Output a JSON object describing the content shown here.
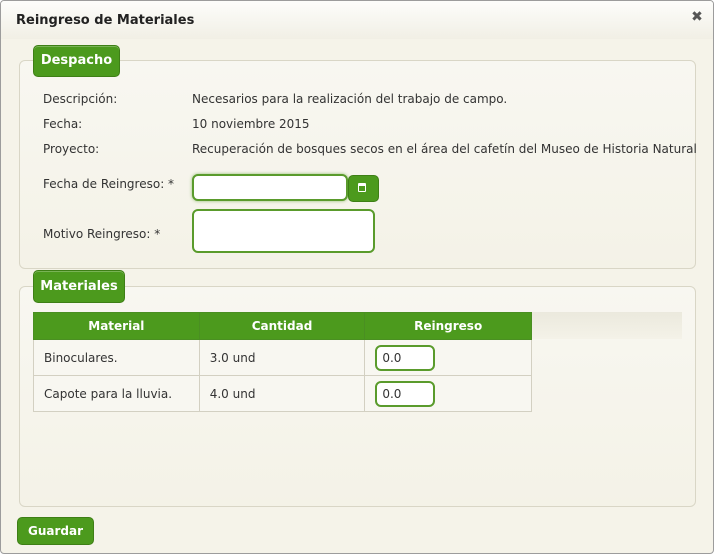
{
  "dialog": {
    "title": "Reingreso de Materiales",
    "close_icon": "close-icon"
  },
  "despacho": {
    "legend": "Despacho",
    "descripcion_label": "Descripción:",
    "descripcion_value": "Necesarios para la realización del trabajo de campo.",
    "fecha_label": "Fecha:",
    "fecha_value": "10 noviembre 2015",
    "proyecto_label": "Proyecto:",
    "proyecto_value": "Recuperación de bosques secos en el área del cafetín del Museo de Historia Natural",
    "fecha_reingreso_label": "Fecha de Reingreso:  *",
    "fecha_reingreso_value": "",
    "calendar_icon": "calendar-icon",
    "motivo_label": "Motivo Reingreso:  *",
    "motivo_value": ""
  },
  "materiales": {
    "legend": "Materiales",
    "columns": [
      "Material",
      "Cantidad",
      "Reingreso"
    ],
    "rows": [
      {
        "material": "Binoculares.",
        "cantidad": "3.0 und",
        "reingreso": "0.0"
      },
      {
        "material": "Capote para la lluvia.",
        "cantidad": "4.0 und",
        "reingreso": "0.0"
      }
    ]
  },
  "footer": {
    "save_label": "Guardar"
  },
  "colors": {
    "accent": "#4c9a1d",
    "background": "#f5f3e9"
  }
}
